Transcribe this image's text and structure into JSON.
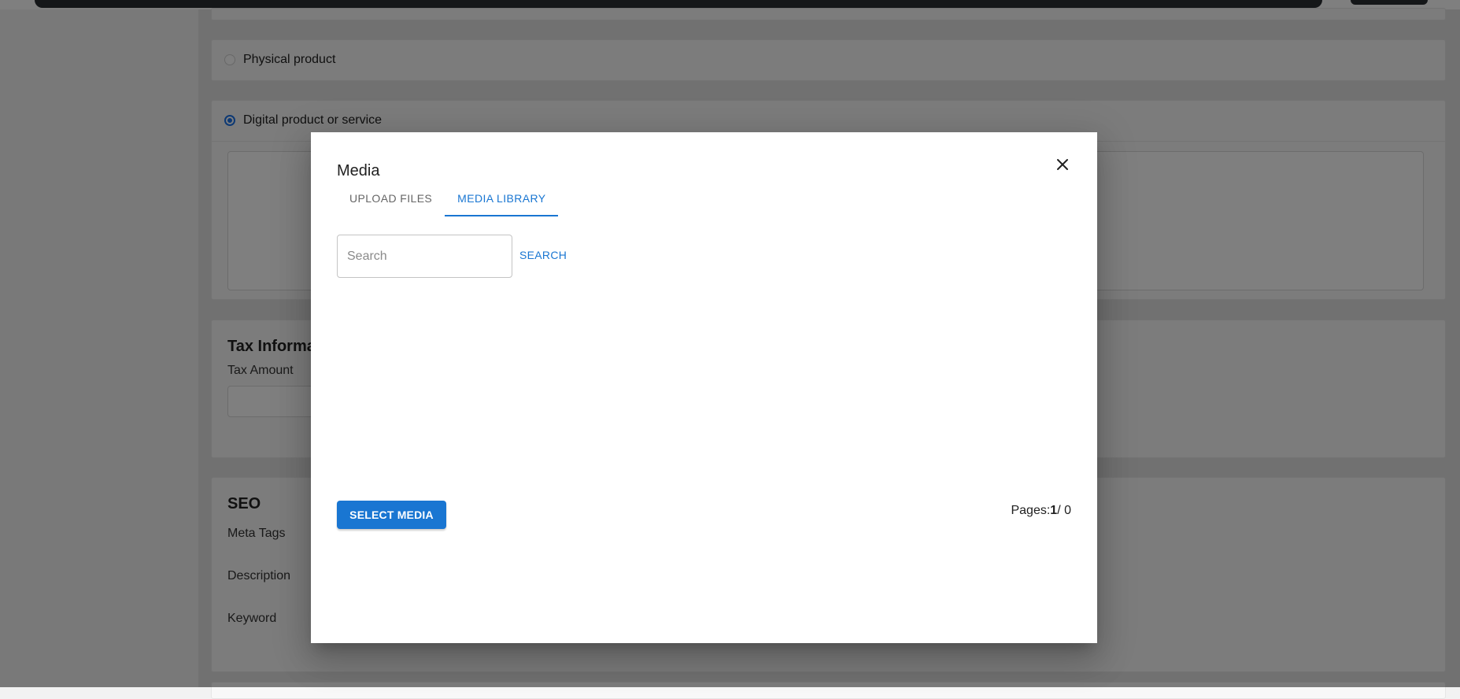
{
  "product_type": {
    "physical_label": "Physical product",
    "digital_label": "Digital product or service",
    "selected": "digital"
  },
  "tax": {
    "title": "Tax Informa",
    "amount_label": "Tax Amount"
  },
  "seo": {
    "title": "SEO",
    "meta_tags_label": "Meta Tags",
    "description_label": "Description",
    "keyword_label": "Keyword"
  },
  "modal": {
    "title": "Media",
    "close_icon": "close-icon",
    "tabs": [
      {
        "label": "UPLOAD FILES",
        "active": false
      },
      {
        "label": "MEDIA LIBRARY",
        "active": true
      }
    ],
    "search": {
      "placeholder": "Search",
      "value": "",
      "button_label": "SEARCH"
    },
    "select_button_label": "SELECT MEDIA",
    "pages": {
      "label": "Pages:",
      "current": "1",
      "separator": "/ 0"
    }
  },
  "colors": {
    "accent": "#1976d2",
    "overlay": "rgba(0,0,0,0.5)"
  }
}
